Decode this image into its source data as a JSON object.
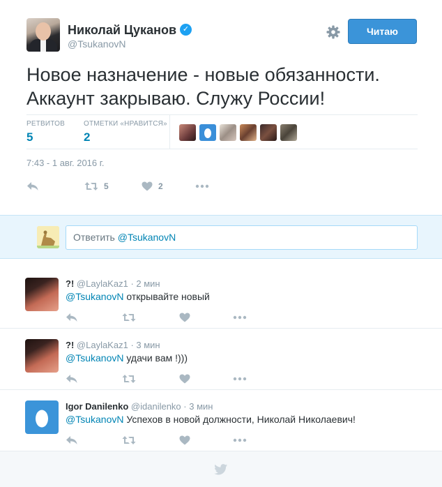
{
  "tweet": {
    "author_name": "Николай Цуканов",
    "author_handle": "@TsukanovN",
    "follow_label": "Читаю",
    "text_line1": "Новое назначение - новые обязанности.",
    "text_line2": "Аккаунт закрываю. Служу России!",
    "retweets_label": "РЕТВИТОВ",
    "retweets_count": "5",
    "likes_label": "ОТМЕТКИ «НРАВИТСЯ»",
    "likes_count": "2",
    "timestamp": "7:43 - 1 авг. 2016 г.",
    "action_retweet_count": "5",
    "action_like_count": "2"
  },
  "reply_box": {
    "prefix": "Ответить ",
    "mention": "@TsukanovN"
  },
  "replies": [
    {
      "name": "?!",
      "handle": "@LaylaKaz1",
      "time": "· 2 мин",
      "mention": "@TsukanovN",
      "text": " открывайте новый"
    },
    {
      "name": "?!",
      "handle": "@LaylaKaz1",
      "time": "· 3 мин",
      "mention": "@TsukanovN",
      "text": " удачи вам !)))"
    },
    {
      "name": "Igor Danilenko",
      "handle": "@idanilenko",
      "time": "· 3 мин",
      "mention": "@TsukanovN",
      "text": " Успехов в новой должности, Николай Николаевич!"
    }
  ],
  "icons": {
    "verified": "verified-badge-icon",
    "settings": "gear-icon",
    "reply": "reply-arrow-icon",
    "retweet": "retweet-icon",
    "like": "heart-icon",
    "more": "more-dots-icon",
    "footer": "twitter-bird-icon"
  },
  "colors": {
    "accent": "#1da1f2",
    "link": "#0084b4",
    "follow_button": "#3b94d9",
    "muted": "#8899a6",
    "reply_bar": "#e8f5fd"
  }
}
